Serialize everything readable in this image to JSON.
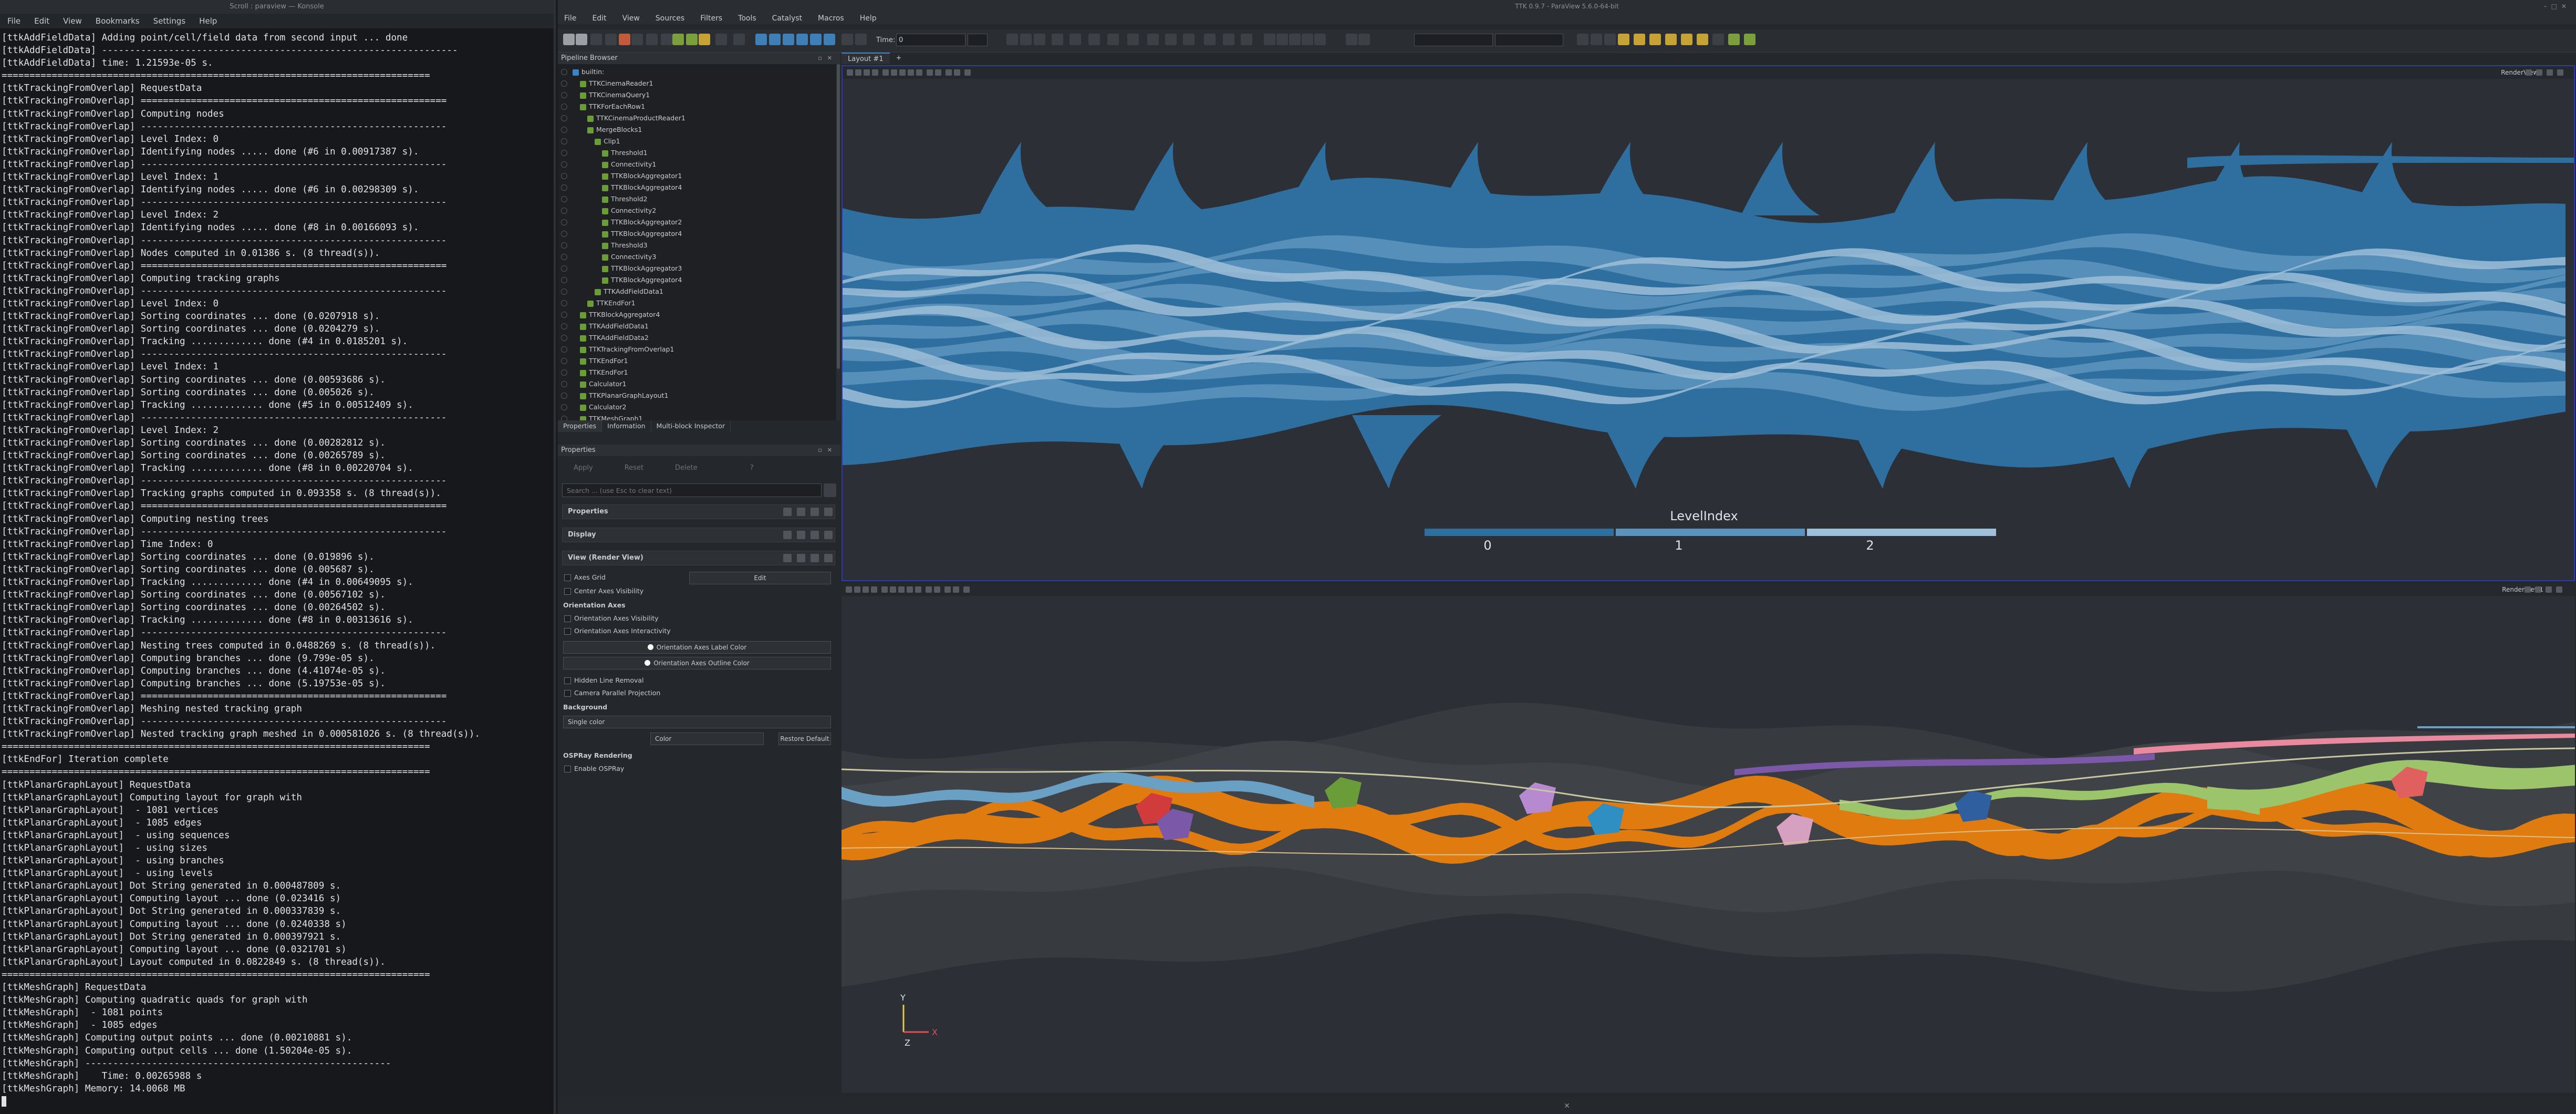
{
  "konsole": {
    "title": "Scroll : paraview — Konsole",
    "menu": [
      "File",
      "Edit",
      "View",
      "Bookmarks",
      "Settings",
      "Help"
    ],
    "lines": [
      "[ttkAddFieldData] Adding point/cell/field data from second input ... done",
      "[ttkAddFieldData] ----------------------------------------------------------------",
      "[ttkAddFieldData] time: 1.21593e-05 s.",
      "=============================================================================",
      "[ttkTrackingFromOverlap] RequestData",
      "[ttkTrackingFromOverlap] =======================================================",
      "[ttkTrackingFromOverlap] Computing nodes",
      "[ttkTrackingFromOverlap] -------------------------------------------------------",
      "[ttkTrackingFromOverlap] Level Index: 0",
      "[ttkTrackingFromOverlap] Identifying nodes ..... done (#6 in 0.00917387 s).",
      "[ttkTrackingFromOverlap] -------------------------------------------------------",
      "[ttkTrackingFromOverlap] Level Index: 1",
      "[ttkTrackingFromOverlap] Identifying nodes ..... done (#6 in 0.00298309 s).",
      "[ttkTrackingFromOverlap] -------------------------------------------------------",
      "[ttkTrackingFromOverlap] Level Index: 2",
      "[ttkTrackingFromOverlap] Identifying nodes ..... done (#8 in 0.00166093 s).",
      "[ttkTrackingFromOverlap] -------------------------------------------------------",
      "[ttkTrackingFromOverlap] Nodes computed in 0.01386 s. (8 thread(s)).",
      "[ttkTrackingFromOverlap] =======================================================",
      "[ttkTrackingFromOverlap] Computing tracking graphs",
      "[ttkTrackingFromOverlap] -------------------------------------------------------",
      "[ttkTrackingFromOverlap] Level Index: 0",
      "[ttkTrackingFromOverlap] Sorting coordinates ... done (0.0207918 s).",
      "[ttkTrackingFromOverlap] Sorting coordinates ... done (0.0204279 s).",
      "[ttkTrackingFromOverlap] Tracking ............. done (#4 in 0.0185201 s).",
      "[ttkTrackingFromOverlap] -------------------------------------------------------",
      "[ttkTrackingFromOverlap] Level Index: 1",
      "[ttkTrackingFromOverlap] Sorting coordinates ... done (0.00593686 s).",
      "[ttkTrackingFromOverlap] Sorting coordinates ... done (0.005026 s).",
      "[ttkTrackingFromOverlap] Tracking ............. done (#5 in 0.00512409 s).",
      "[ttkTrackingFromOverlap] -------------------------------------------------------",
      "[ttkTrackingFromOverlap] Level Index: 2",
      "[ttkTrackingFromOverlap] Sorting coordinates ... done (0.00282812 s).",
      "[ttkTrackingFromOverlap] Sorting coordinates ... done (0.00265789 s).",
      "[ttkTrackingFromOverlap] Tracking ............. done (#8 in 0.00220704 s).",
      "[ttkTrackingFromOverlap] -------------------------------------------------------",
      "[ttkTrackingFromOverlap] Tracking graphs computed in 0.093358 s. (8 thread(s)).",
      "[ttkTrackingFromOverlap] =======================================================",
      "[ttkTrackingFromOverlap] Computing nesting trees",
      "[ttkTrackingFromOverlap] -------------------------------------------------------",
      "[ttkTrackingFromOverlap] Time Index: 0",
      "[ttkTrackingFromOverlap] Sorting coordinates ... done (0.019896 s).",
      "[ttkTrackingFromOverlap] Sorting coordinates ... done (0.005687 s).",
      "[ttkTrackingFromOverlap] Tracking ............. done (#4 in 0.00649095 s).",
      "[ttkTrackingFromOverlap] Sorting coordinates ... done (0.00567102 s).",
      "[ttkTrackingFromOverlap] Sorting coordinates ... done (0.00264502 s).",
      "[ttkTrackingFromOverlap] Tracking ............. done (#8 in 0.00313616 s).",
      "[ttkTrackingFromOverlap] -------------------------------------------------------",
      "[ttkTrackingFromOverlap] Nesting trees computed in 0.0488269 s. (8 thread(s)).",
      "[ttkTrackingFromOverlap] Computing branches ... done (9.799e-05 s).",
      "[ttkTrackingFromOverlap] Computing branches ... done (4.41074e-05 s).",
      "[ttkTrackingFromOverlap] Computing branches ... done (5.19753e-05 s).",
      "[ttkTrackingFromOverlap] =======================================================",
      "[ttkTrackingFromOverlap] Meshing nested tracking graph",
      "[ttkTrackingFromOverlap] -------------------------------------------------------",
      "[ttkTrackingFromOverlap] Nested tracking graph meshed in 0.000581026 s. (8 thread(s)).",
      "=============================================================================",
      "[ttkEndFor] Iteration complete",
      "=============================================================================",
      "[ttkPlanarGraphLayout] RequestData",
      "[ttkPlanarGraphLayout] Computing layout for graph with",
      "[ttkPlanarGraphLayout]  - 1081 vertices",
      "[ttkPlanarGraphLayout]  - 1085 edges",
      "[ttkPlanarGraphLayout]  - using sequences",
      "[ttkPlanarGraphLayout]  - using sizes",
      "[ttkPlanarGraphLayout]  - using branches",
      "[ttkPlanarGraphLayout]  - using levels",
      "[ttkPlanarGraphLayout] Dot String generated in 0.000487809 s.",
      "[ttkPlanarGraphLayout] Computing layout ... done (0.023416 s)",
      "[ttkPlanarGraphLayout] Dot String generated in 0.000337839 s.",
      "[ttkPlanarGraphLayout] Computing layout ... done (0.0240338 s)",
      "[ttkPlanarGraphLayout] Dot String generated in 0.000397921 s.",
      "[ttkPlanarGraphLayout] Computing layout ... done (0.0321701 s)",
      "[ttkPlanarGraphLayout] Layout computed in 0.0822849 s. (8 thread(s)).",
      "=============================================================================",
      "[ttkMeshGraph] RequestData",
      "[ttkMeshGraph] Computing quadratic quads for graph with",
      "[ttkMeshGraph]  - 1081 points",
      "[ttkMeshGraph]  - 1085 edges",
      "[ttkMeshGraph] Computing output points ... done (0.00210881 s).",
      "[ttkMeshGraph] Computing output cells ... done (1.50204e-05 s).",
      "[ttkMeshGraph] -------------------------------------------------------",
      "[ttkMeshGraph]    Time: 0.00265988 s",
      "[ttkMeshGraph] Memory: 14.0068 MB"
    ]
  },
  "paraview": {
    "title": "TTK 0.9.7 - ParaView 5.6.0-64-bit",
    "menu": [
      "File",
      "Edit",
      "View",
      "Sources",
      "Filters",
      "Tools",
      "Catalyst",
      "Macros",
      "Help"
    ],
    "time_label": "Time:",
    "time_value": "0",
    "pipeline": {
      "title": "Pipeline Browser",
      "items": [
        {
          "label": "builtin:",
          "indent": 0
        },
        {
          "label": "TTKCinemaReader1",
          "indent": 1
        },
        {
          "label": "TTKCinemaQuery1",
          "indent": 1
        },
        {
          "label": "TTKForEachRow1",
          "indent": 1
        },
        {
          "label": "TTKCinemaProductReader1",
          "indent": 2
        },
        {
          "label": "MergeBlocks1",
          "indent": 2
        },
        {
          "label": "Clip1",
          "indent": 3
        },
        {
          "label": "Threshold1",
          "indent": 4
        },
        {
          "label": "Connectivity1",
          "indent": 4
        },
        {
          "label": "TTKBlockAggregator1",
          "indent": 4
        },
        {
          "label": "TTKBlockAggregator4",
          "indent": 4
        },
        {
          "label": "Threshold2",
          "indent": 4
        },
        {
          "label": "Connectivity2",
          "indent": 4
        },
        {
          "label": "TTKBlockAggregator2",
          "indent": 4
        },
        {
          "label": "TTKBlockAggregator4",
          "indent": 4
        },
        {
          "label": "Threshold3",
          "indent": 4
        },
        {
          "label": "Connectivity3",
          "indent": 4
        },
        {
          "label": "TTKBlockAggregator3",
          "indent": 4
        },
        {
          "label": "TTKBlockAggregator4",
          "indent": 4
        },
        {
          "label": "TTKAddFieldData1",
          "indent": 3
        },
        {
          "label": "TTKEndFor1",
          "indent": 2
        },
        {
          "label": "TTKBlockAggregator4",
          "indent": 1
        },
        {
          "label": "TTKAddFieldData1",
          "indent": 1
        },
        {
          "label": "TTKAddFieldData2",
          "indent": 1
        },
        {
          "label": "TTKTrackingFromOverlap1",
          "indent": 1
        },
        {
          "label": "TTKEndFor1",
          "indent": 1
        },
        {
          "label": "TTKEndFor1",
          "indent": 1
        },
        {
          "label": "Calculator1",
          "indent": 1
        },
        {
          "label": "TTKPlanarGraphLayout1",
          "indent": 1
        },
        {
          "label": "Calculator2",
          "indent": 1
        },
        {
          "label": "TTKMeshGraph1",
          "indent": 1
        }
      ]
    },
    "bottom_tabs": [
      "Properties",
      "Information",
      "Multi-block Inspector"
    ],
    "properties": {
      "title": "Properties",
      "apply": "Apply",
      "reset": "Reset",
      "delete": "Delete",
      "help": "?",
      "search_placeholder": "Search ... (use Esc to clear text)",
      "sections": [
        "Properties",
        "Display",
        "View (Render View)"
      ],
      "axes_grid": "Axes Grid",
      "edit": "Edit",
      "center_axes": "Center Axes Visibility",
      "orientation_axes": "Orientation Axes",
      "oa_visibility": "Orientation Axes Visibility",
      "oa_interactivity": "Orientation Axes Interactivity",
      "oa_label_color": "Orientation Axes Label Color",
      "oa_outline_color": "Orientation Axes Outline Color",
      "hidden_line": "Hidden Line Removal",
      "camera_parallel": "Camera Parallel Projection",
      "background": "Background",
      "single_color": "Single color",
      "color": "Color",
      "restore_default": "Restore Default",
      "ospray": "OSPRay Rendering",
      "enable_ospray": "Enable OSPRay"
    },
    "layout_tabs": [
      "Layout #1",
      "+"
    ],
    "view_top": {
      "name": "RenderView2",
      "legend_title": "LevelIndex",
      "legend_labels": [
        "0",
        "1",
        "2"
      ],
      "legend_colors": [
        "#2f6f9f",
        "#5b93bd",
        "#9fc0d8"
      ]
    },
    "view_bottom": {
      "name": "RenderView1",
      "axes": {
        "y": "Y",
        "z": "Z",
        "x": "X"
      }
    }
  }
}
